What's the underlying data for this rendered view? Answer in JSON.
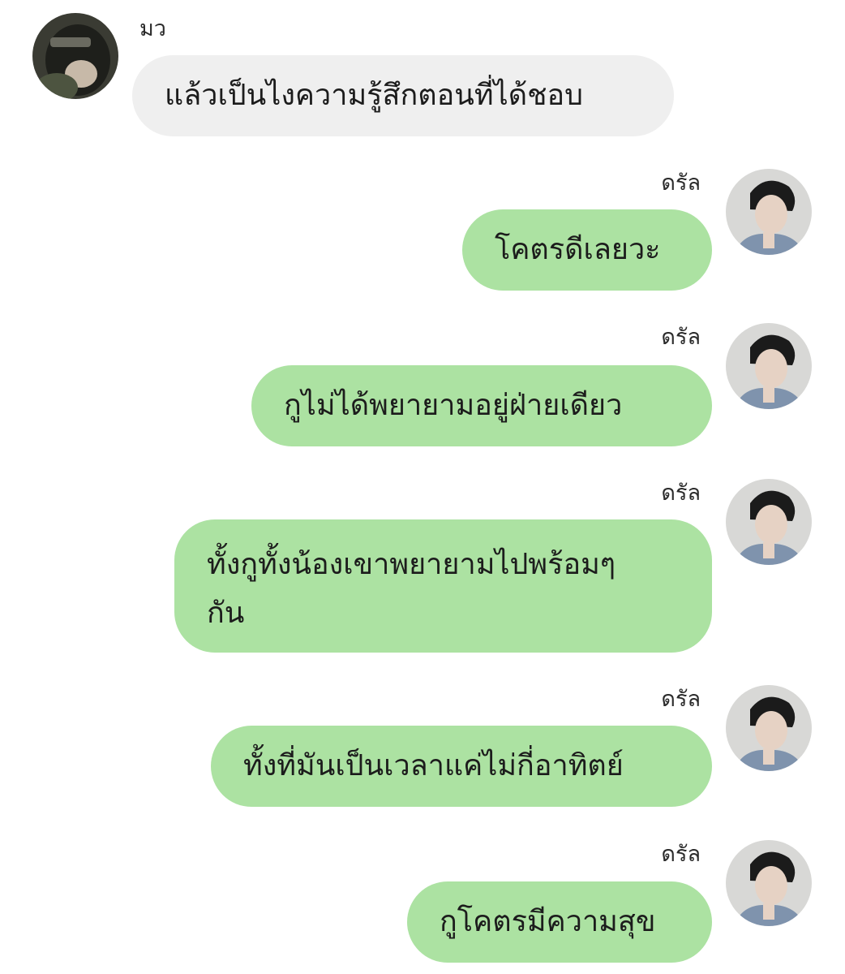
{
  "messages": [
    {
      "sender": "มว",
      "direction": "incoming",
      "text": "แล้วเป็นไงความรู้สึกตอนที่ได้ชอบ",
      "avatar_icon": "profile-photo-hood-icon"
    },
    {
      "sender": "ดรัล",
      "direction": "outgoing",
      "text": "โคตรดีเลยวะ",
      "avatar_icon": "profile-photo-man-icon"
    },
    {
      "sender": "ดรัล",
      "direction": "outgoing",
      "text": "กูไม่ได้พยายามอยู่ฝ่ายเดียว",
      "avatar_icon": "profile-photo-man-icon"
    },
    {
      "sender": "ดรัล",
      "direction": "outgoing",
      "text_line1": "ทั้งกูทั้งน้องเขาพยายามไปพร้อมๆ",
      "text_line2": "กัน",
      "avatar_icon": "profile-photo-man-icon"
    },
    {
      "sender": "ดรัล",
      "direction": "outgoing",
      "text": "ทั้งที่มันเป็นเวลาแค่ไม่กี่อาทิตย์",
      "avatar_icon": "profile-photo-man-icon"
    },
    {
      "sender": "ดรัล",
      "direction": "outgoing",
      "text": "กูโคตรมีความสุข",
      "avatar_icon": "profile-photo-man-icon"
    }
  ],
  "colors": {
    "incoming_bubble": "#efefef",
    "outgoing_bubble": "#ace2a2",
    "background": "#ffffff"
  }
}
